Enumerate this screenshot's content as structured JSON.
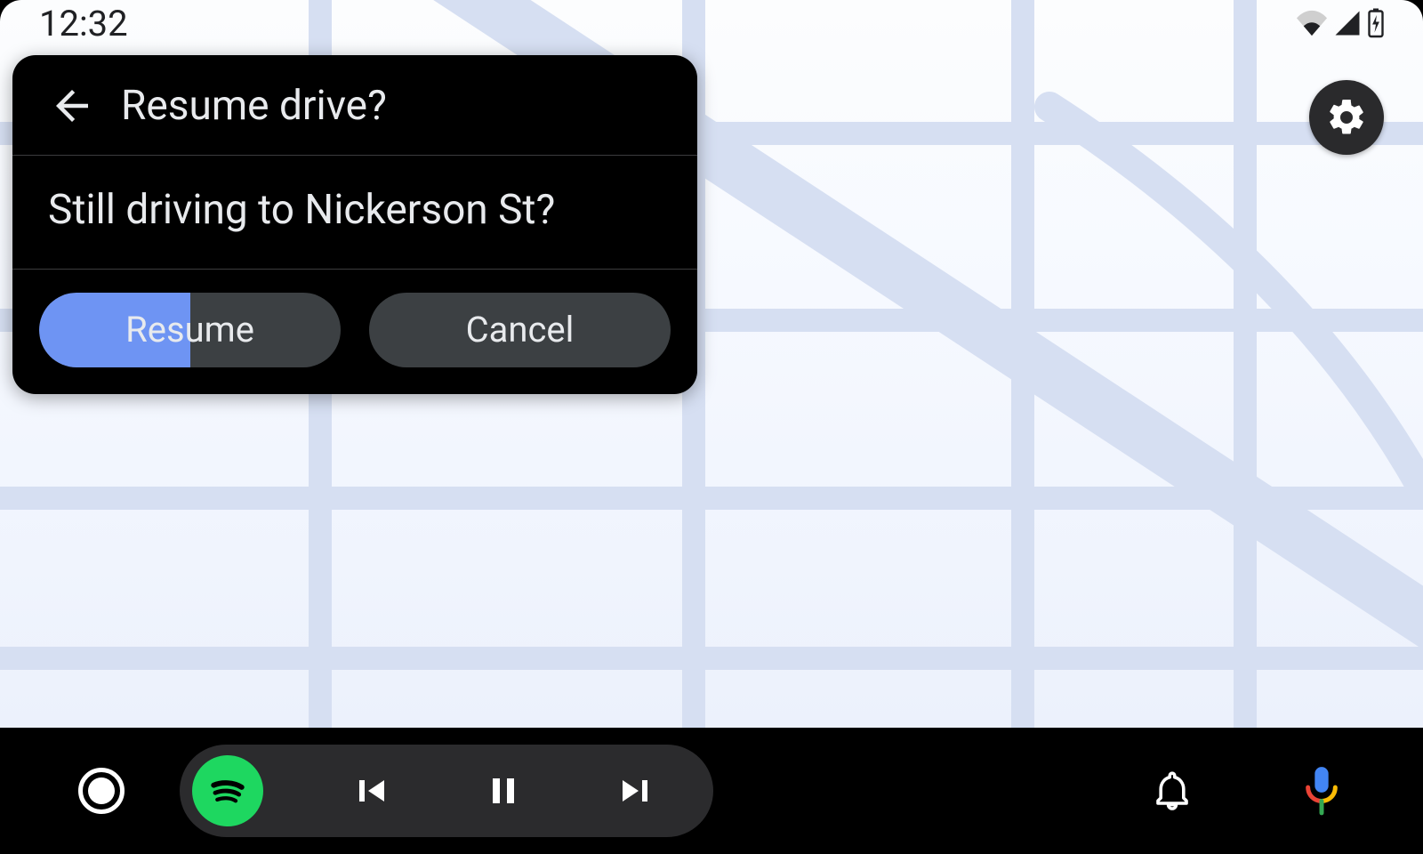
{
  "status_bar": {
    "time": "12:32",
    "icons": {
      "wifi": "wifi-icon",
      "signal": "cellular-icon",
      "battery": "battery-charging-icon"
    }
  },
  "settings_fab": {
    "icon": "gear-icon"
  },
  "prompt": {
    "back_icon": "arrow-back-icon",
    "title": "Resume drive?",
    "body": "Still driving to Nickerson St?",
    "actions": {
      "primary": {
        "label": "Resume",
        "progress_percent": 50
      },
      "secondary": {
        "label": "Cancel"
      }
    }
  },
  "nav_bar": {
    "home_icon": "home-circle-icon",
    "media": {
      "app_icon": "spotify-icon",
      "prev_icon": "skip-previous-icon",
      "playpause_icon": "pause-icon",
      "next_icon": "skip-next-icon"
    },
    "notifications_icon": "bell-icon",
    "voice_icon": "google-mic-icon"
  },
  "colors": {
    "accent_blue": "#6e94f3",
    "spotify_green": "#1ed760",
    "card_bg": "#000000",
    "pill_grey": "#3c4043"
  }
}
